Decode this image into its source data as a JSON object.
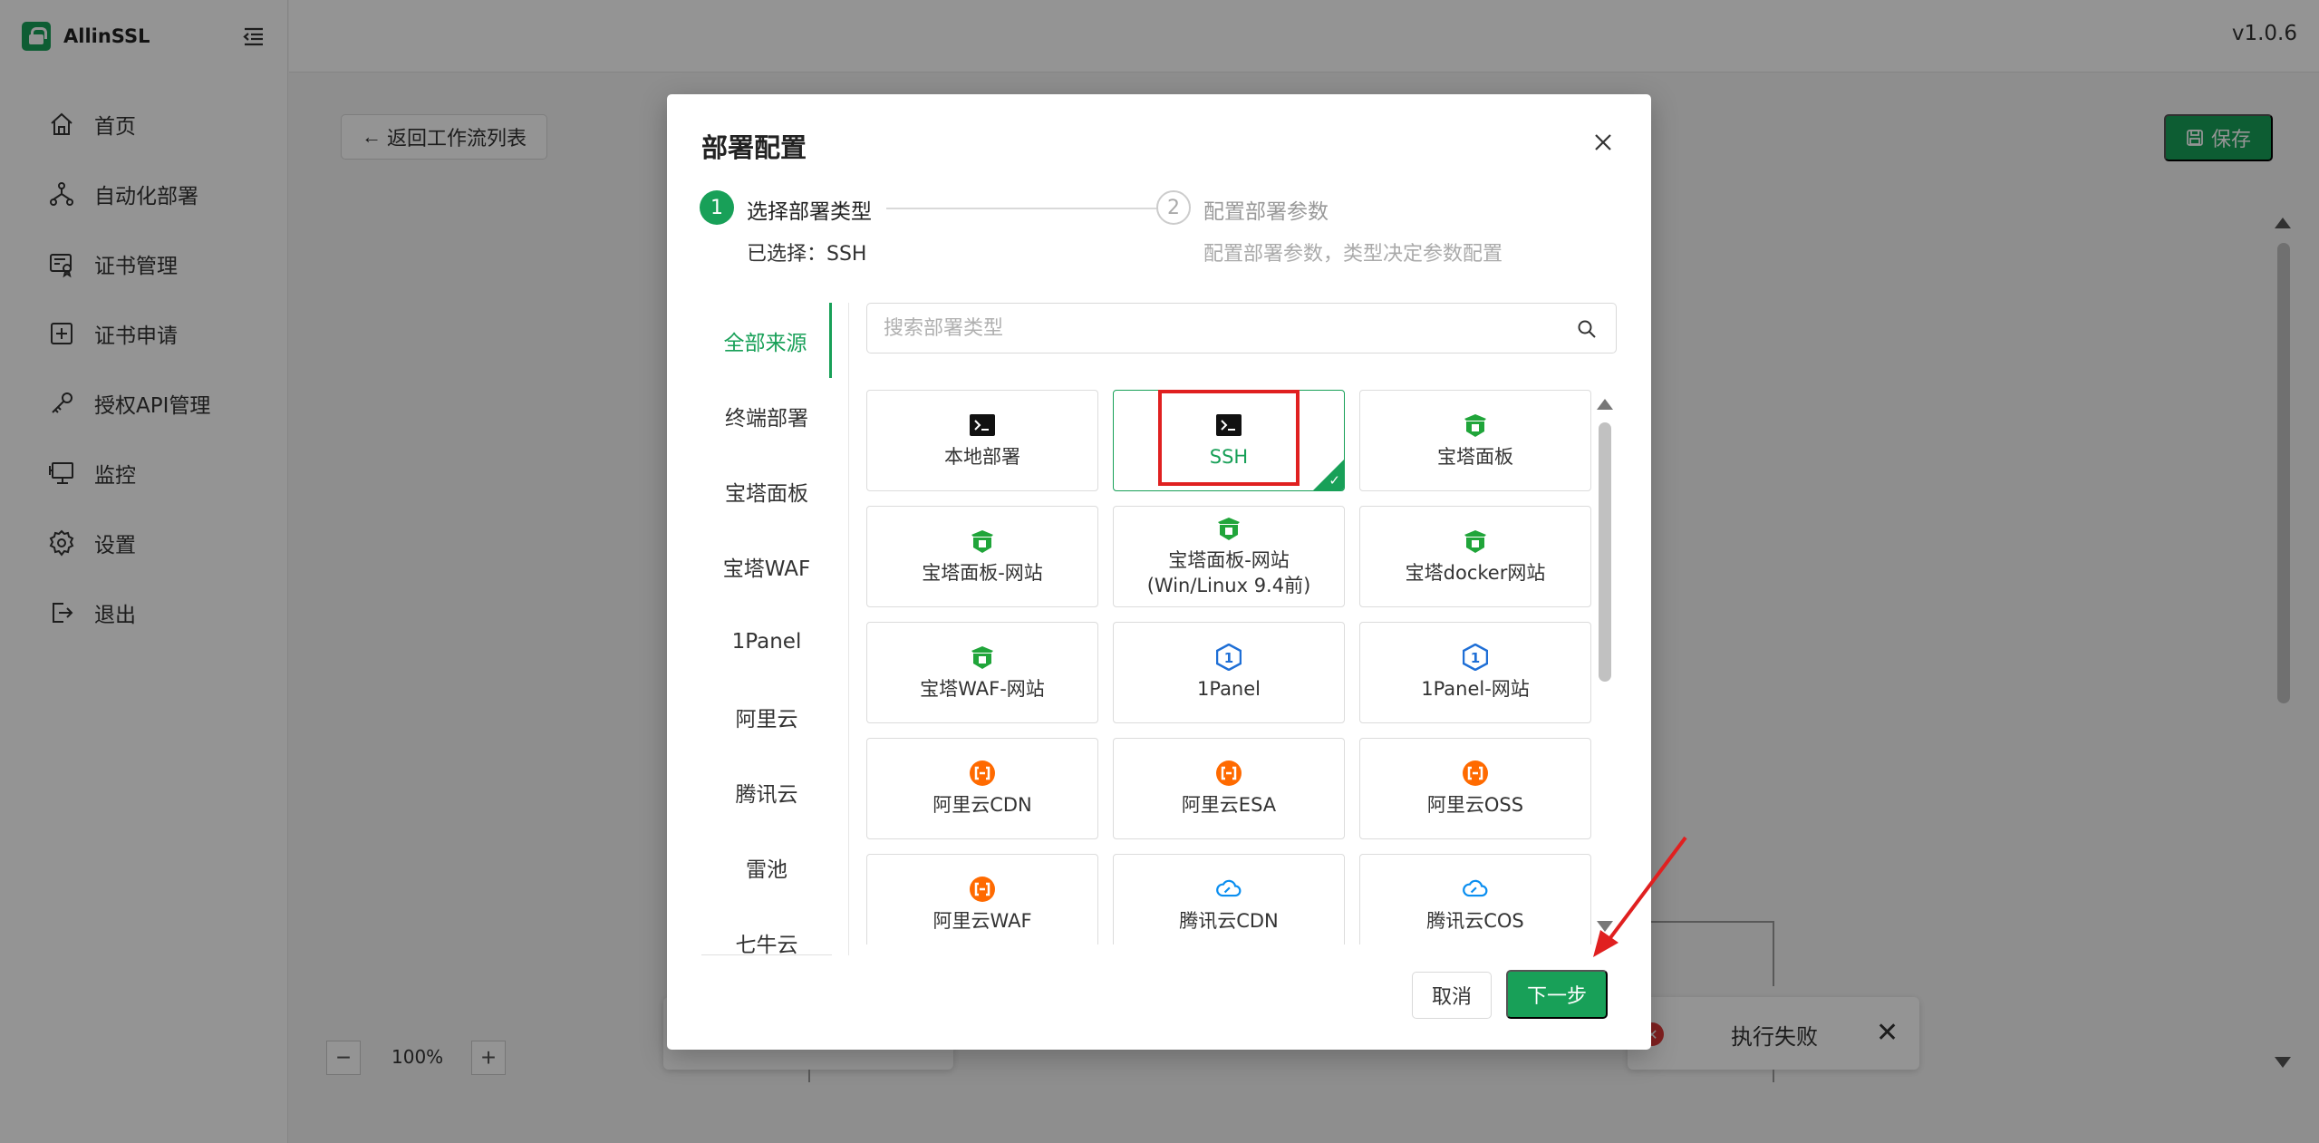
{
  "app": {
    "name": "AllinSSL",
    "version": "v1.0.6"
  },
  "sidebar": {
    "items": [
      {
        "label": "首页",
        "icon": "home-icon"
      },
      {
        "label": "自动化部署",
        "icon": "workflow-icon"
      },
      {
        "label": "证书管理",
        "icon": "certificate-icon"
      },
      {
        "label": "证书申请",
        "icon": "add-square-icon"
      },
      {
        "label": "授权API管理",
        "icon": "api-key-icon"
      },
      {
        "label": "监控",
        "icon": "monitor-icon"
      },
      {
        "label": "设置",
        "icon": "settings-icon"
      },
      {
        "label": "退出",
        "icon": "logout-icon"
      }
    ]
  },
  "toolbar": {
    "back_label": "返回工作流列表",
    "save_label": "保存"
  },
  "canvas": {
    "zoom": "100%",
    "fail_text": "执行失败"
  },
  "modal": {
    "title": "部署配置",
    "steps": [
      {
        "num": "1",
        "title": "选择部署类型",
        "desc": "已选择：SSH"
      },
      {
        "num": "2",
        "title": "配置部署参数",
        "desc": "配置部署参数，类型决定参数配置"
      }
    ],
    "categories": [
      "全部来源",
      "终端部署",
      "宝塔面板",
      "宝塔WAF",
      "1Panel",
      "阿里云",
      "腾讯云",
      "雷池",
      "七牛云"
    ],
    "active_category": "全部来源",
    "search": {
      "placeholder": "搜索部署类型",
      "value": ""
    },
    "selected": "SSH",
    "cards": [
      {
        "label": "本地部署",
        "icon": "terminal-icon"
      },
      {
        "label": "SSH",
        "icon": "terminal-icon"
      },
      {
        "label": "宝塔面板",
        "icon": "baota-icon"
      },
      {
        "label": "宝塔面板-网站",
        "icon": "baota-icon"
      },
      {
        "label": "宝塔面板-网站\n(Win/Linux 9.4前)",
        "icon": "baota-icon"
      },
      {
        "label": "宝塔docker网站",
        "icon": "baota-icon"
      },
      {
        "label": "宝塔WAF-网站",
        "icon": "baota-icon"
      },
      {
        "label": "1Panel",
        "icon": "1panel-icon"
      },
      {
        "label": "1Panel-网站",
        "icon": "1panel-icon"
      },
      {
        "label": "阿里云CDN",
        "icon": "aliyun-icon"
      },
      {
        "label": "阿里云ESA",
        "icon": "aliyun-icon"
      },
      {
        "label": "阿里云OSS",
        "icon": "aliyun-icon"
      },
      {
        "label": "阿里云WAF",
        "icon": "aliyun-icon"
      },
      {
        "label": "腾讯云CDN",
        "icon": "tencent-cloud-icon"
      },
      {
        "label": "腾讯云COS",
        "icon": "tencent-cloud-icon"
      }
    ],
    "cancel_label": "取消",
    "next_label": "下一步"
  },
  "colors": {
    "accent": "#18a058",
    "error": "#e03a3a",
    "annotation": "#e02020",
    "aliyun": "#ff6a00",
    "tencent": "#0a8ef0",
    "onepanel": "#1f6fd6"
  }
}
